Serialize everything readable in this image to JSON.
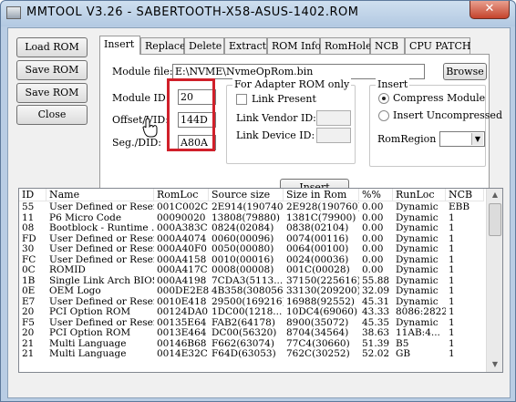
{
  "window": {
    "title": "MMTOOL V3.26 - SABERTOOTH-X58-ASUS-1402.ROM",
    "close_glyph": "✕"
  },
  "left_buttons": {
    "load_rom": "Load ROM",
    "save_rom": "Save ROM",
    "save_rom_as": "Save ROM as..",
    "close": "Close"
  },
  "tabs": [
    "Insert",
    "Replace",
    "Delete",
    "Extract",
    "ROM Info",
    "RomHole",
    "NCB",
    "CPU PATCH"
  ],
  "active_tab": "Insert",
  "insert": {
    "module_file_label": "Module file:",
    "module_file_value": "E:\\NVME\\NvmeOpRom.bin",
    "browse": "Browse",
    "module_id_label": "Module ID:",
    "module_id_value": "20",
    "offset_vid_label": "Offset/VID:",
    "offset_vid_value": "144D",
    "seg_did_label": "Seg./DID:",
    "seg_did_value": "A80A",
    "adapter_group_title": "For Adapter ROM only",
    "link_present": "Link Present",
    "link_vendor_id": "Link Vendor ID:",
    "link_device_id": "Link Device ID:",
    "insert_button": "Insert",
    "insert_group_title": "Insert",
    "compress_module": "Compress Module",
    "insert_uncompressed": "Insert Uncompressed",
    "compress_selected": true,
    "rom_region_label": "RomRegion",
    "dropdown_arrow": "▼"
  },
  "table": {
    "columns": [
      "ID",
      "Name",
      "RomLoc",
      "Source size",
      "Size in Rom",
      "%%",
      "RunLoc",
      "NCB"
    ],
    "rows": [
      [
        "55",
        "User Defined or Reser...",
        "001C002C",
        "2E914(190740)",
        "2E928(190760)",
        "0.00",
        "Dynamic",
        "EBB"
      ],
      [
        "11",
        "P6 Micro Code",
        "00090020",
        "13808(79880)",
        "1381C(79900)",
        "0.00",
        "Dynamic",
        "1"
      ],
      [
        "08",
        "Bootblock - Runtime ...",
        "000A383C",
        "0824(02084)",
        "0838(02104)",
        "0.00",
        "Dynamic",
        "1"
      ],
      [
        "FD",
        "User Defined or Reser...",
        "000A4074",
        "0060(00096)",
        "0074(00116)",
        "0.00",
        "Dynamic",
        "1"
      ],
      [
        "30",
        "User Defined or Reser...",
        "000A40F0",
        "0050(00080)",
        "0064(00100)",
        "0.00",
        "Dynamic",
        "1"
      ],
      [
        "FC",
        "User Defined or Reser...",
        "000A4158",
        "0010(00016)",
        "0024(00036)",
        "0.00",
        "Dynamic",
        "1"
      ],
      [
        "0C",
        "ROMID",
        "000A417C",
        "0008(00008)",
        "001C(00028)",
        "0.00",
        "Dynamic",
        "1"
      ],
      [
        "1B",
        "Single Link Arch BIOS",
        "000A4198",
        "7CDA3(5113...",
        "37150(225616)",
        "55.88",
        "Dynamic",
        "1"
      ],
      [
        "0E",
        "OEM Logo",
        "000DE2E8",
        "4B358(308056)",
        "33130(209200)",
        "32.09",
        "Dynamic",
        "1"
      ],
      [
        "E7",
        "User Defined or Reser...",
        "0010E418",
        "29500(169216)",
        "16988(92552)",
        "45.31",
        "Dynamic",
        "1"
      ],
      [
        "20",
        "PCI Option ROM",
        "00124DA0",
        "1DC00(1218...",
        "10DC4(69060)",
        "43.33",
        "8086:2822",
        "1"
      ],
      [
        "F5",
        "User Defined or Reser...",
        "00135E64",
        "FAB2(64178)",
        "8900(35072)",
        "45.35",
        "Dynamic",
        "1"
      ],
      [
        "20",
        "PCI Option ROM",
        "0013E464",
        "DC00(56320)",
        "8704(34564)",
        "38.63",
        "11AB:4...",
        "1"
      ],
      [
        "21",
        "Multi Language",
        "00146B68",
        "F662(63074)",
        "77C4(30660)",
        "51.39",
        "B5",
        "1"
      ],
      [
        "21",
        "Multi Language",
        "0014E32C",
        "F64D(63053)",
        "762C(30252)",
        "52.02",
        "GB",
        "1"
      ]
    ]
  }
}
